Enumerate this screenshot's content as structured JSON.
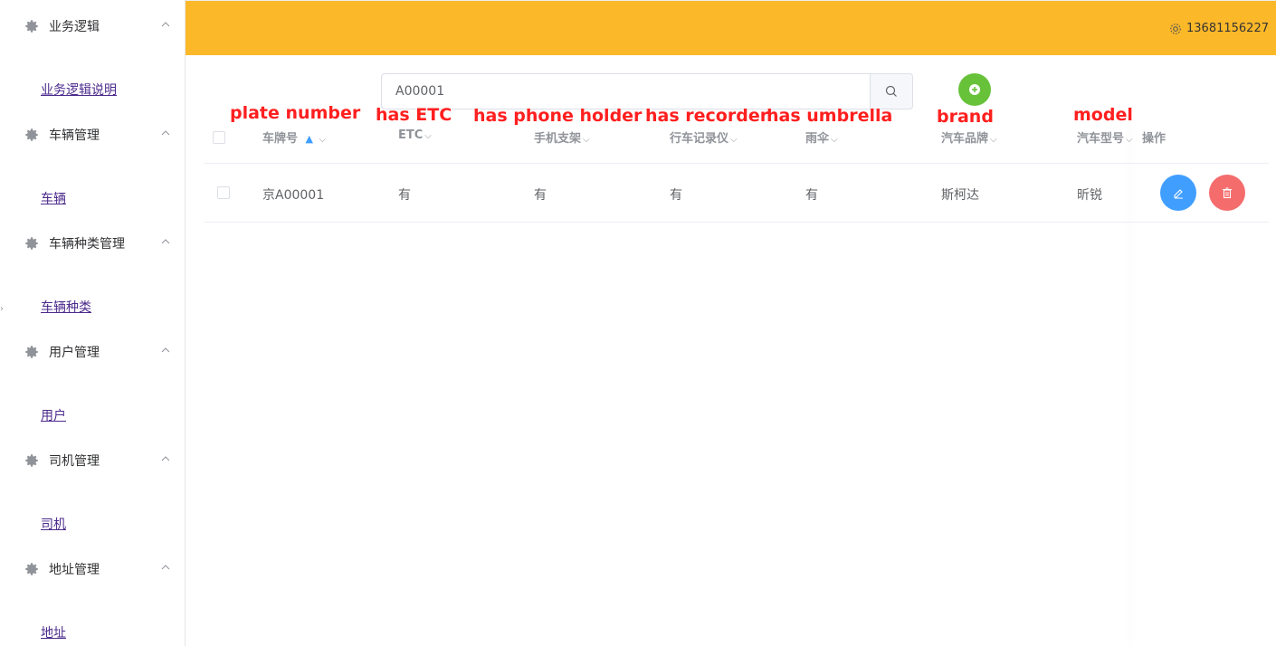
{
  "sidebar": {
    "groups": [
      {
        "title": "业务逻辑",
        "link": "业务逻辑说明"
      },
      {
        "title": "车辆管理",
        "link": "车辆"
      },
      {
        "title": "车辆种类管理",
        "link": "车辆种类"
      },
      {
        "title": "用户管理",
        "link": "用户"
      },
      {
        "title": "司机管理",
        "link": "司机"
      },
      {
        "title": "地址管理",
        "link": "地址"
      }
    ]
  },
  "topbar": {
    "user": "13681156227",
    "accent": "#fbb829"
  },
  "search": {
    "value": "A00001",
    "placeholder": ""
  },
  "annotations": {
    "plate": "plate number",
    "etc": "has ETC",
    "phone": "has phone holder",
    "recorder": "has recorder",
    "umbrella": "has umbrella",
    "brand": "brand",
    "model": "model"
  },
  "table": {
    "headers": {
      "plate": "车牌号",
      "etc": "ETC",
      "phone": "手机支架",
      "recorder": "行车记录仪",
      "umbrella": "雨伞",
      "brand": "汽车品牌",
      "model": "汽车型号",
      "ops": "操作"
    },
    "rows": [
      {
        "plate": "京A00001",
        "etc": "有",
        "phone": "有",
        "recorder": "有",
        "umbrella": "有",
        "brand": "斯柯达",
        "model": "昕锐"
      }
    ]
  },
  "colors": {
    "edit": "#409eff",
    "delete": "#f56c6c",
    "add": "#67c23a",
    "annotation": "#ff1f1f"
  },
  "icons": {
    "menu": "gear-icon",
    "search": "search-icon",
    "add": "plus-circle-icon",
    "edit": "edit-icon",
    "delete": "delete-icon"
  }
}
